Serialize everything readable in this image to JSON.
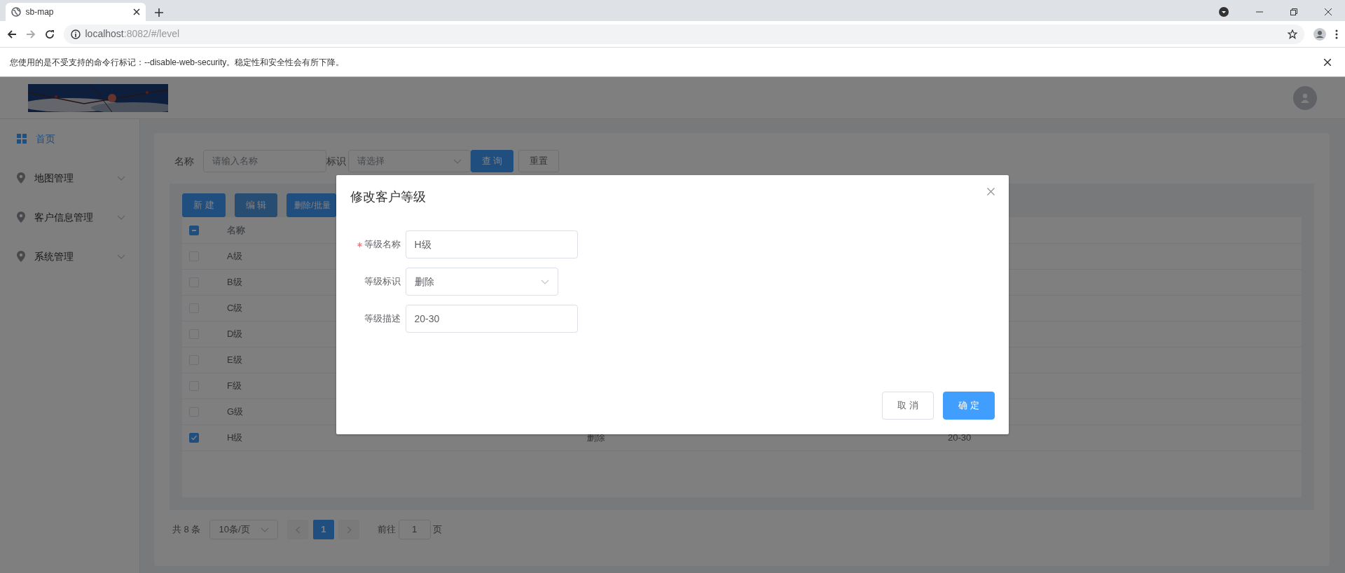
{
  "browser": {
    "tab_title": "sb-map",
    "url_host": "localhost",
    "url_rest": ":8082/#/level",
    "warning": "您使用的是不受支持的命令行标记：--disable-web-security。稳定性和安全性会有所下降。"
  },
  "sidebar": {
    "items": [
      {
        "label": "首页",
        "kind": "link",
        "selected": true
      },
      {
        "label": "地图管理",
        "kind": "submenu",
        "selected": false
      },
      {
        "label": "客户信息管理",
        "kind": "submenu",
        "selected": false
      },
      {
        "label": "系统管理",
        "kind": "submenu",
        "selected": false
      }
    ]
  },
  "search": {
    "fields": [
      {
        "label": "名称",
        "kind": "input",
        "placeholder": "请输入名称"
      },
      {
        "label": "标识",
        "kind": "select",
        "placeholder": "请选择"
      }
    ],
    "buttons": [
      {
        "label": "查 询",
        "kind": "primary"
      },
      {
        "label": "重置",
        "kind": "default"
      }
    ]
  },
  "toolbar": {
    "buttons": [
      {
        "label": "新 建",
        "disabled": false
      },
      {
        "label": "编 辑",
        "disabled": true
      },
      {
        "label": "删除/批量",
        "disabled": false
      }
    ]
  },
  "table": {
    "select_all_indeterminate": true,
    "columns": [
      "名称"
    ],
    "rows": [
      {
        "cells": [
          "A级"
        ],
        "checked": false
      },
      {
        "cells": [
          "B级"
        ],
        "checked": false
      },
      {
        "cells": [
          "C级"
        ],
        "checked": false
      },
      {
        "cells": [
          "D级"
        ],
        "checked": false
      },
      {
        "cells": [
          "E级"
        ],
        "checked": false
      },
      {
        "cells": [
          "F级"
        ],
        "checked": false
      },
      {
        "cells": [
          "G级"
        ],
        "checked": false
      },
      {
        "cells": [
          "H级",
          "删除",
          "20-30"
        ],
        "checked": true
      }
    ]
  },
  "pagination": {
    "total": "共 8 条",
    "page_size": "10条/页",
    "pages": [
      {
        "label": "1",
        "selected": true
      }
    ],
    "goto_label": "前往",
    "goto_value": "1",
    "goto_suffix": "页"
  },
  "dialog": {
    "title": "修改客户等级",
    "fields": [
      {
        "label": "等级名称",
        "required": true,
        "kind": "input",
        "value": "H级"
      },
      {
        "label": "等级标识",
        "required": false,
        "kind": "select",
        "value": "删除"
      },
      {
        "label": "等级描述",
        "required": false,
        "kind": "input",
        "value": "20-30"
      }
    ],
    "buttons": [
      {
        "label": "取 消",
        "kind": "default"
      },
      {
        "label": "确 定",
        "kind": "primary"
      }
    ]
  }
}
